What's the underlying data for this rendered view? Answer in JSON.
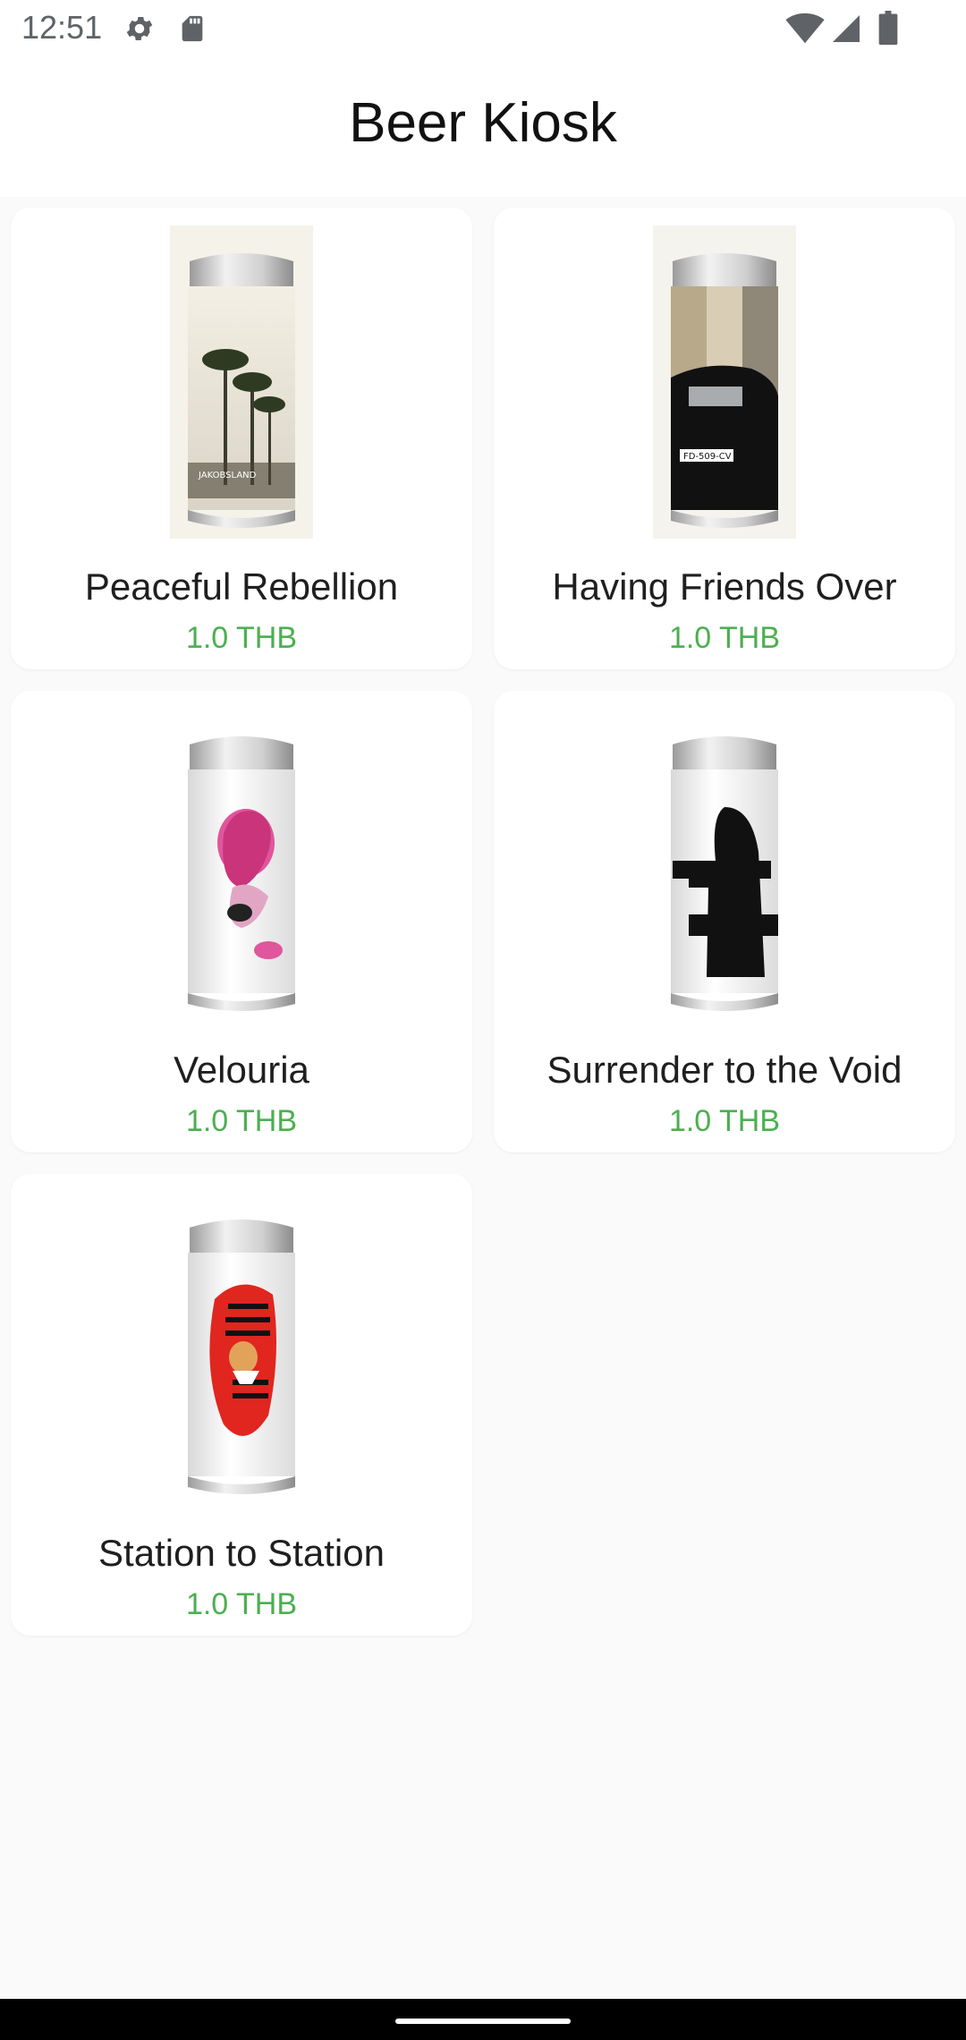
{
  "status_bar": {
    "time": "12:51",
    "icons": [
      "gear-icon",
      "sd-card-icon",
      "wifi-icon",
      "signal-icon",
      "battery-icon"
    ]
  },
  "app_bar": {
    "title": "Beer Kiosk"
  },
  "products": [
    {
      "name": "Peaceful Rebellion",
      "price": "1.0 THB",
      "image": "palm-trees-can"
    },
    {
      "name": "Having Friends Over",
      "price": "1.0 THB",
      "image": "black-car-can"
    },
    {
      "name": "Velouria",
      "price": "1.0 THB",
      "image": "pink-collage-can"
    },
    {
      "name": "Surrender to the Void",
      "price": "1.0 THB",
      "image": "black-figure-can"
    },
    {
      "name": "Station to Station",
      "price": "1.0 THB",
      "image": "red-striped-face-can"
    }
  ],
  "colors": {
    "price": "#4caf50",
    "background": "#fafafa",
    "card": "#ffffff"
  }
}
